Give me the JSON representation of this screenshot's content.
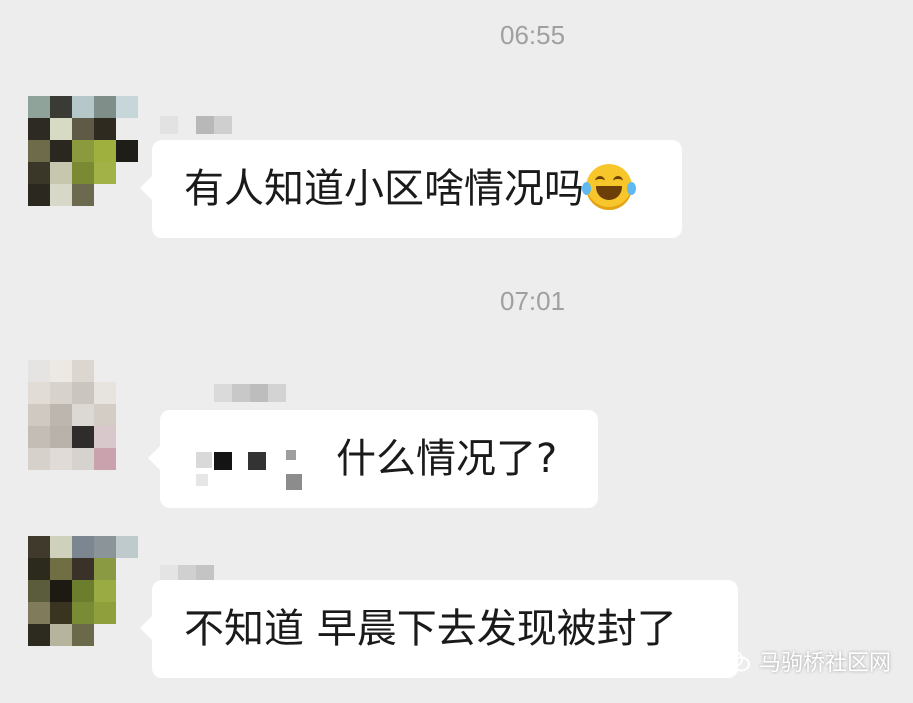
{
  "chat": {
    "timestamps": [
      "06:55",
      "07:01"
    ],
    "messages": [
      {
        "text": "有人知道小区啥情况吗",
        "emoji": "face-with-tears-of-joy"
      },
      {
        "text": "什么情况了?"
      },
      {
        "text": "不知道  早晨下去发现被封了"
      }
    ]
  },
  "watermark": {
    "text": "马驹桥社区网"
  },
  "colors": {
    "background": "#ededed",
    "bubble": "#ffffff",
    "text": "#1a1a1a",
    "timestamp": "#a0a0a0"
  }
}
